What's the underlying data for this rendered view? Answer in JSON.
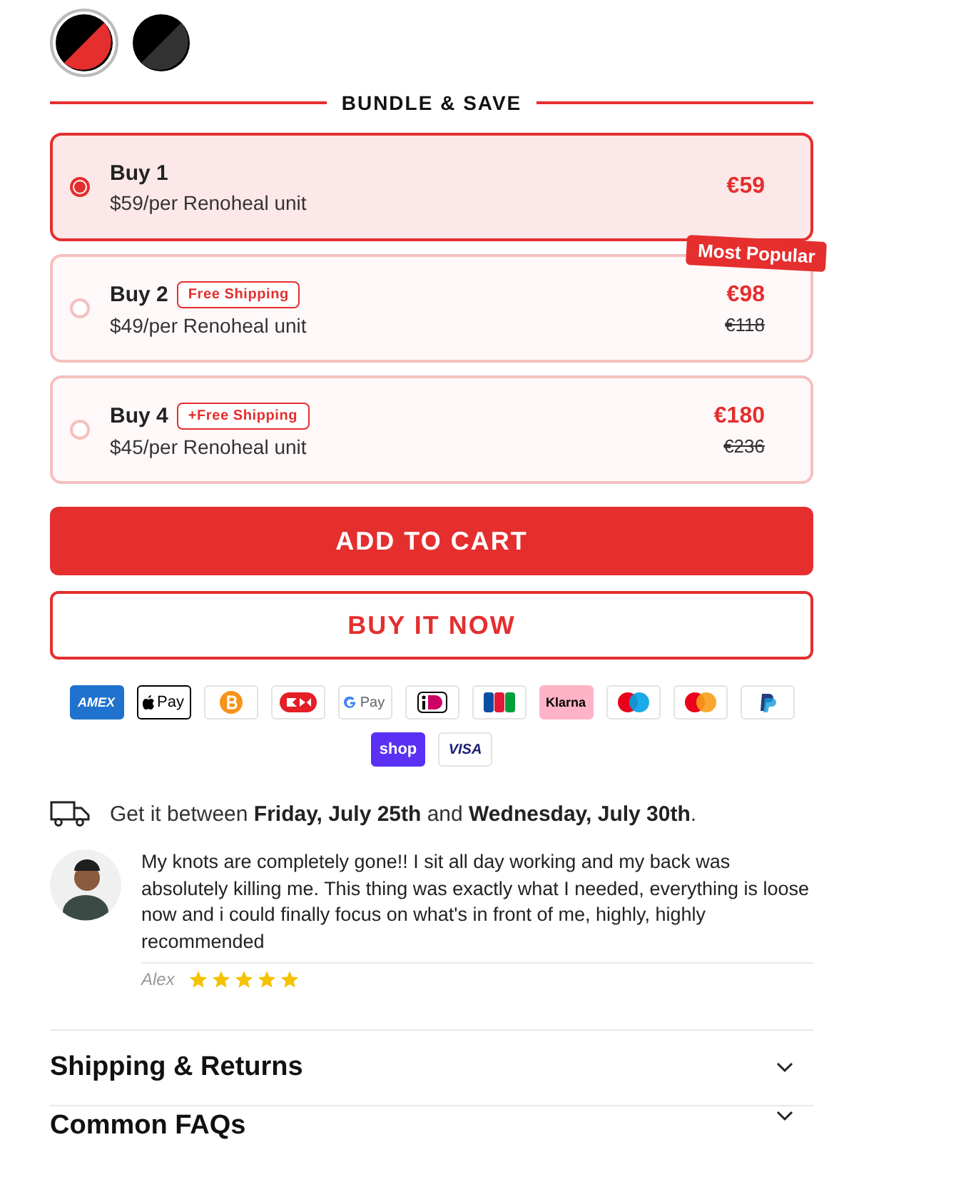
{
  "swatches": [
    {
      "color": "#e52e2e",
      "selected": true
    },
    {
      "color": "#333333",
      "selected": false
    }
  ],
  "bundle": {
    "heading": "BUNDLE & SAVE",
    "options": [
      {
        "title": "Buy 1",
        "subtitle": "$59/per Renoheal unit",
        "price": "€59",
        "selected": true
      },
      {
        "title": "Buy 2",
        "badge": "Free Shipping",
        "subtitle": "$49/per Renoheal unit",
        "price": "€98",
        "old_price": "€118",
        "ribbon": "Most Popular",
        "selected": false
      },
      {
        "title": "Buy 4",
        "badge": "+Free Shipping",
        "subtitle": "$45/per Renoheal unit",
        "price": "€180",
        "old_price": "€236",
        "selected": false
      }
    ]
  },
  "buttons": [
    {
      "label": "ADD TO CART",
      "kind": "primary"
    },
    {
      "label": "BUY IT NOW",
      "kind": "outline"
    }
  ],
  "payments": [
    {
      "kind": "amex",
      "label": "AMEX"
    },
    {
      "kind": "applepay",
      "label": "Pay"
    },
    {
      "kind": "bitcoin"
    },
    {
      "kind": "dankort"
    },
    {
      "kind": "gpay",
      "label": "Pay"
    },
    {
      "kind": "ideal"
    },
    {
      "kind": "jcb"
    },
    {
      "kind": "klarna",
      "label": "Klarna"
    },
    {
      "kind": "maestro"
    },
    {
      "kind": "mastercard"
    },
    {
      "kind": "paypal"
    },
    {
      "kind": "shop",
      "label": "shop"
    },
    {
      "kind": "visa",
      "label": "VISA"
    }
  ],
  "delivery": "Get it between **Friday, July 25th** and **Wednesday, July 30th**.",
  "review": {
    "text": "My knots are completely gone!! I sit all day working and my back was absolutely killing me. This thing was exactly what I needed, everything is loose now and i could finally focus on what's in front of me, highly, highly recommended",
    "author": "Alex",
    "stars": 5
  },
  "accordion": [
    {
      "title": "Shipping & Returns",
      "expanded": false
    },
    {
      "title": "Common FAQs",
      "expanded": false
    }
  ]
}
